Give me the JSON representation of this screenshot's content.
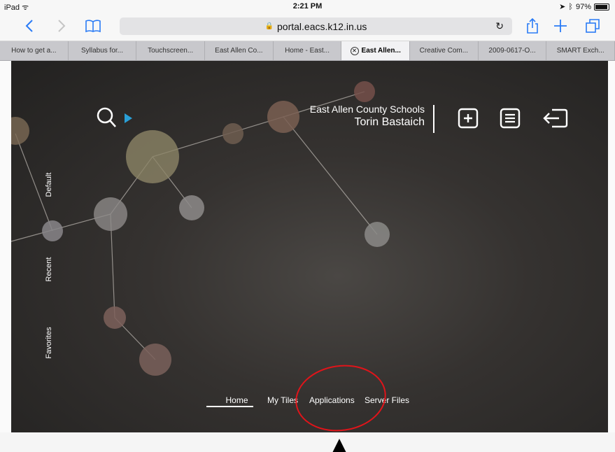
{
  "status_bar": {
    "device": "iPad",
    "time": "2:21 PM",
    "battery": "97%"
  },
  "toolbar": {
    "url": "portal.eacs.k12.in.us"
  },
  "tabs": [
    {
      "label": "How to get a..."
    },
    {
      "label": "Syllabus for..."
    },
    {
      "label": "Touchscreen..."
    },
    {
      "label": "East Allen Co..."
    },
    {
      "label": "Home - East..."
    },
    {
      "label": "East Allen..."
    },
    {
      "label": "Creative Com..."
    },
    {
      "label": "2009-0617-O..."
    },
    {
      "label": "SMART Exch..."
    }
  ],
  "portal": {
    "school": "East Allen County Schools",
    "user": "Torin Bastaich",
    "side_nav": [
      "Default",
      "Recent",
      "Favorites"
    ],
    "bottom_nav": [
      "Home",
      "My Tiles",
      "Applications",
      "Server Files"
    ],
    "active_tab": "Home"
  },
  "colors": {
    "accent": "#2a7bf6",
    "annotation": "#e0141a",
    "search_arrow": "#2a9fd6"
  }
}
